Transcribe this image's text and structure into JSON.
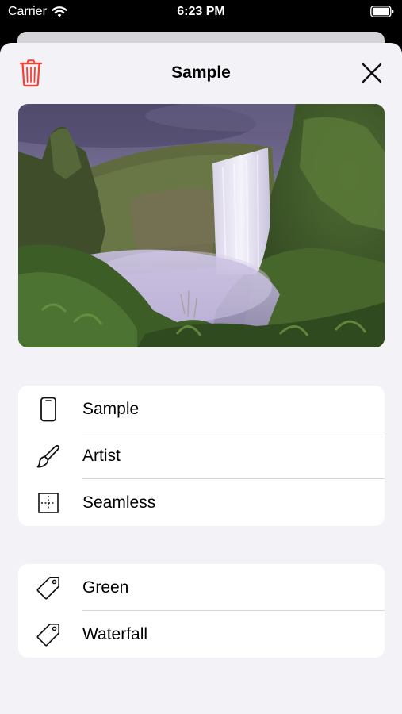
{
  "status_bar": {
    "carrier": "Carrier",
    "time": "6:23 PM",
    "wifi_icon": "wifi-icon",
    "battery_icon": "battery-icon"
  },
  "nav": {
    "title": "Sample",
    "delete_icon": "trash-icon",
    "close_icon": "close-icon"
  },
  "photo": {
    "subject": "waterfall-landscape"
  },
  "info_rows": [
    {
      "label": "Sample",
      "icon": "phone-icon"
    },
    {
      "label": "Artist",
      "icon": "paintbrush-icon"
    },
    {
      "label": "Seamless",
      "icon": "seamless-grid-icon"
    }
  ],
  "tag_rows": [
    {
      "label": "Green",
      "icon": "tag-icon"
    },
    {
      "label": "Waterfall",
      "icon": "tag-icon"
    }
  ],
  "colors": {
    "destructive": "#ff3b30",
    "sheet_background": "#f2f2f7",
    "card_background": "#ffffff"
  }
}
